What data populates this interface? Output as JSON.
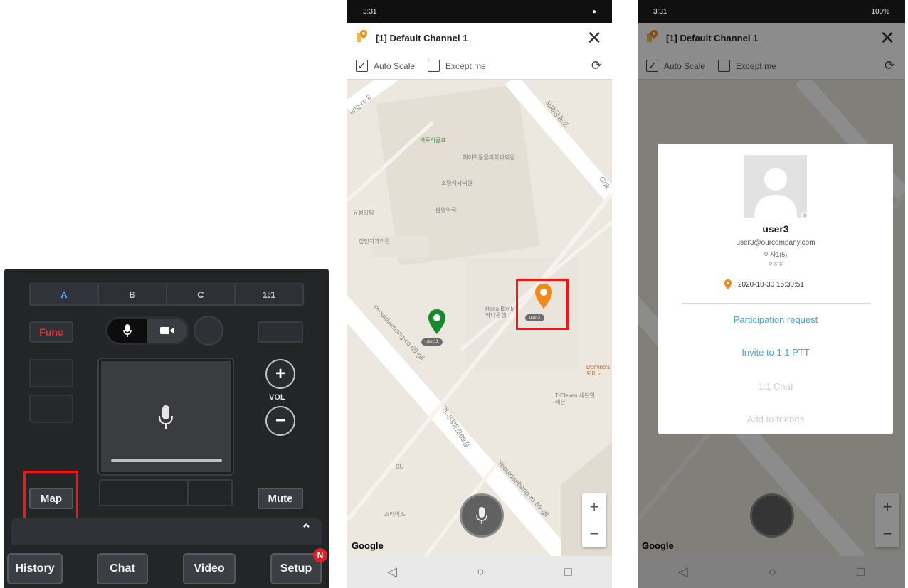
{
  "console": {
    "channels": [
      "A",
      "B",
      "C",
      "1:1"
    ],
    "func_label": "Func",
    "vol_label": "VOL",
    "vol_plus": "+",
    "vol_minus": "−",
    "map_label": "Map",
    "mute_label": "Mute",
    "bottom": [
      "History",
      "Chat",
      "Video",
      "Setup"
    ],
    "setup_badge": "N"
  },
  "screen": {
    "status_time": "3:31",
    "status_right": "100%",
    "channel_title": "[1] Default Channel 1",
    "close": "✕",
    "auto_scale": "Auto Scale",
    "except_me": "Except me",
    "refresh": "⟳",
    "zoom_in": "+",
    "zoom_out": "−",
    "google": "Google"
  },
  "map": {
    "roads": [
      "ung-ro 8",
      "국제금융로",
      "Guk",
      "Yeouidaebang-ro 69-gil",
      "여의대방로69길",
      "Yeouidaebang-ro 69-gil"
    ],
    "pois": [
      "벽두리골프",
      "헤이위동물의학과의원",
      "조량치과의원",
      "삼양약국",
      "유성빌딩",
      "정인치과의원",
      "Hana Bank 하나은행",
      "T-Eleven 세븐일레븐",
      "Domino's 도미노",
      "CU",
      "스타벅스"
    ],
    "pins": [
      {
        "label": "user11",
        "color": "#1b8a2e"
      },
      {
        "label": "user3",
        "color": "#f08a18"
      }
    ]
  },
  "dialog": {
    "name": "user3",
    "email": "user3@ourcompany.com",
    "dept": "이사1(5)",
    "extra": "ㅇㅎㅎ",
    "timestamp": "2020-10-30 15:30:51",
    "actions": [
      "Participation request",
      "Invite to 1:1 PTT",
      "1:1 Chat",
      "Add to friends"
    ],
    "colors": {
      "active": "#3aa9d4",
      "disabled": "#d0d0d0"
    }
  }
}
